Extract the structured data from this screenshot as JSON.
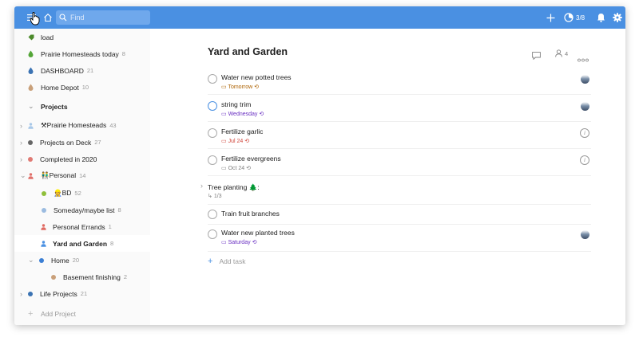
{
  "topbar": {
    "search_placeholder": "Find",
    "karma": "3/8",
    "icons": [
      "menu-icon",
      "home-icon",
      "search-icon",
      "add-icon",
      "productivity-icon",
      "bell-icon",
      "gear-icon"
    ]
  },
  "sidebar": {
    "items": [
      {
        "label": "load",
        "count": "",
        "color": "#4c8a2b"
      },
      {
        "label": "Prairie Homesteads today",
        "count": "8",
        "color": "#53a537"
      },
      {
        "label": "DASHBOARD",
        "count": "21",
        "color": "#3b73b3"
      },
      {
        "label": "Home Depot",
        "count": "10",
        "color": "#c9a07a"
      },
      {
        "label": "Projects",
        "count": ""
      },
      {
        "label": "⚒Prairie Homesteads",
        "count": "43",
        "color": "#a8c8e8"
      },
      {
        "label": "Projects on Deck",
        "count": "27",
        "color": "#666666"
      },
      {
        "label": "Completed in 2020",
        "count": "",
        "color": "#e07a74"
      },
      {
        "label": "👬Personal",
        "count": "14",
        "color": "#e0706a"
      },
      {
        "label": "👷BD",
        "count": "52",
        "color": "#8fbf3a"
      },
      {
        "label": "Someday/maybe list",
        "count": "8",
        "color": "#9bbbe0"
      },
      {
        "label": "Personal Errands",
        "count": "1",
        "color": "#e06a62"
      },
      {
        "label": "Yard and Garden",
        "count": "8",
        "color": "#4a90e2"
      },
      {
        "label": "Home",
        "count": "20",
        "color": "#3b7fd4"
      },
      {
        "label": "Basement finishing",
        "count": "2",
        "color": "#c9a07a"
      },
      {
        "label": "Life Projects",
        "count": "21",
        "color": "#3b73b3"
      }
    ],
    "add_project": "Add Project"
  },
  "main": {
    "title": "Yard and Garden",
    "people_count": "4",
    "tasks": [
      {
        "name": "Water new potted trees",
        "date": "Tomorrow",
        "date_color": "#ad6200"
      },
      {
        "name": "string trim",
        "date": "Wednesday",
        "date_color": "#692fc2"
      },
      {
        "name": "Fertilize garlic",
        "date": "Jul 24",
        "date_color": "#d1453b"
      },
      {
        "name": "Fertilize evergreens",
        "date": "Oct 24",
        "date_color": "#808080"
      },
      {
        "name": "Tree planting 🌲:",
        "subtasks": "1/3"
      },
      {
        "name": "Train fruit branches"
      },
      {
        "name": "Water new planted trees",
        "date": "Saturday",
        "date_color": "#692fc2"
      }
    ],
    "add_task": "Add task"
  }
}
